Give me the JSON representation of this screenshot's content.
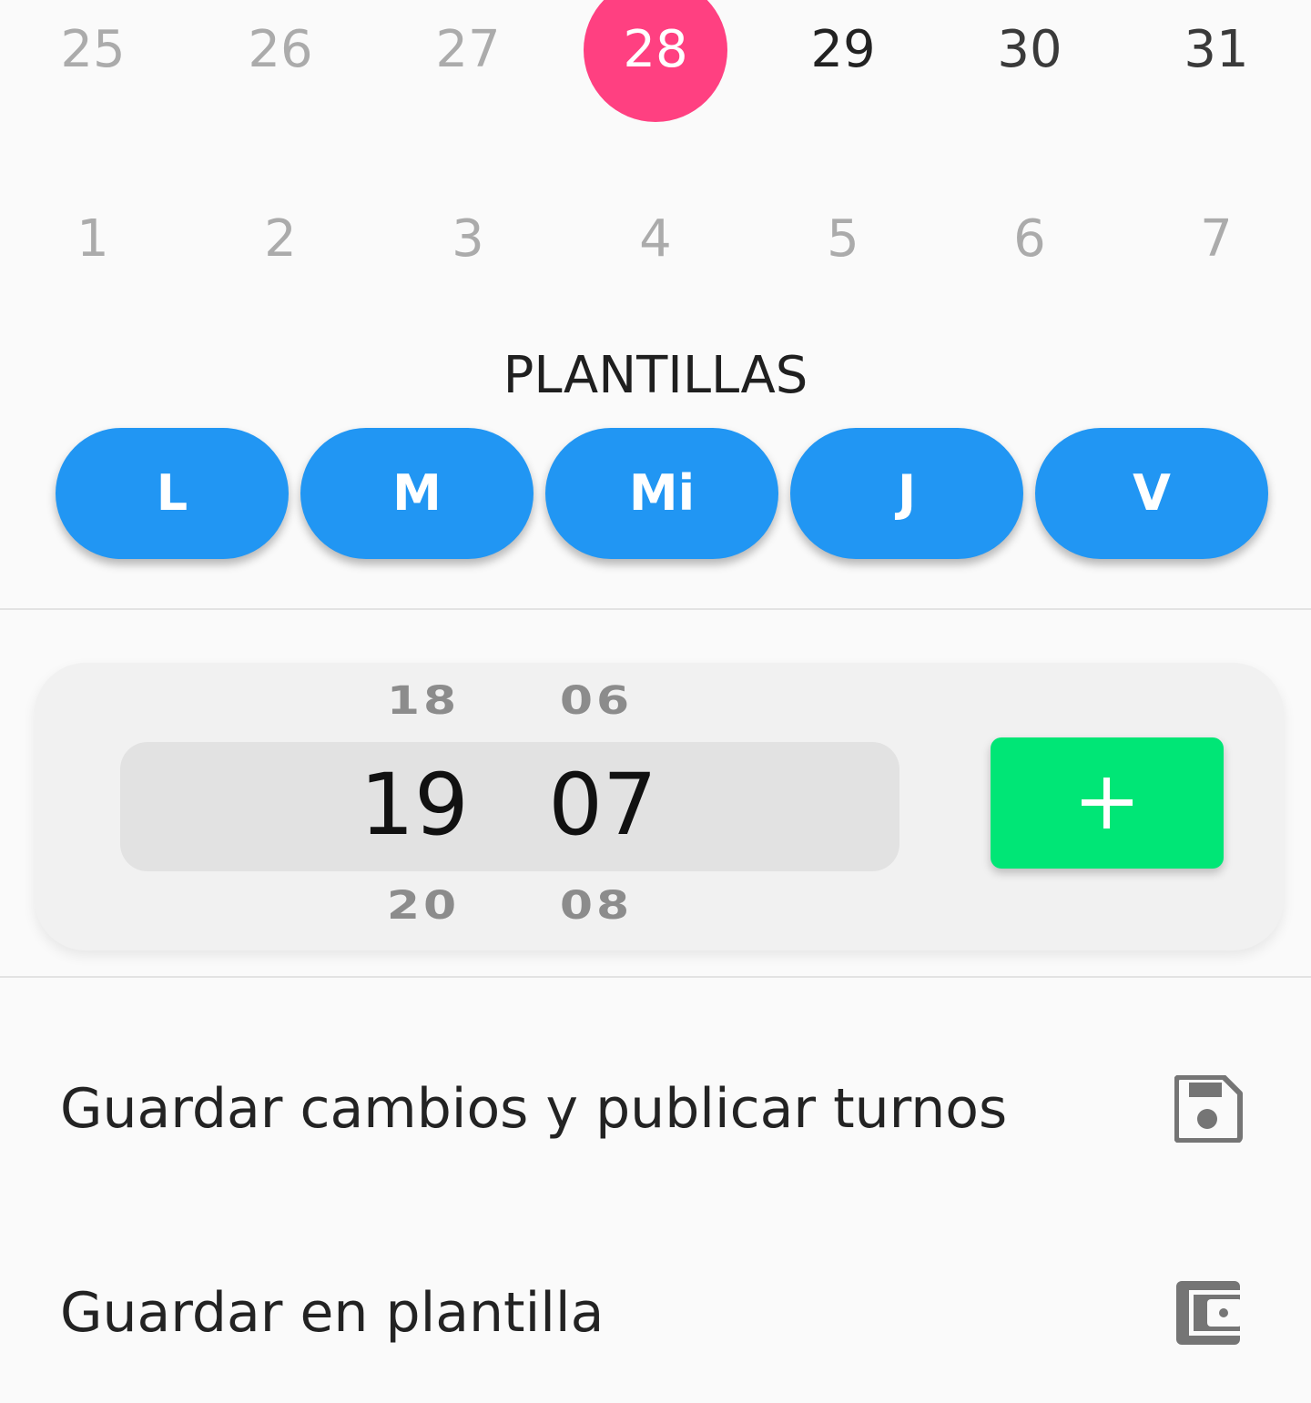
{
  "calendar": {
    "row1": [
      "25",
      "26",
      "27",
      "28",
      "29",
      "30",
      "31"
    ],
    "row2": [
      "1",
      "2",
      "3",
      "4",
      "5",
      "6",
      "7"
    ],
    "selected_day": "28",
    "selected_color": "#ff4081"
  },
  "templates": {
    "title": "PLANTILLAS",
    "days": [
      "L",
      "M",
      "Mi",
      "J",
      "V"
    ],
    "button_color": "#2196f3"
  },
  "time_picker": {
    "hours": {
      "prev": "18",
      "current": "19",
      "next": "20"
    },
    "minutes": {
      "prev": "06",
      "current": "07",
      "next": "08"
    },
    "add_icon": "plus-icon",
    "add_color": "#00e676"
  },
  "actions": [
    {
      "label": "Guardar cambios y publicar turnos",
      "icon": "save-icon"
    },
    {
      "label": "Guardar en plantilla",
      "icon": "wallet-icon"
    }
  ]
}
